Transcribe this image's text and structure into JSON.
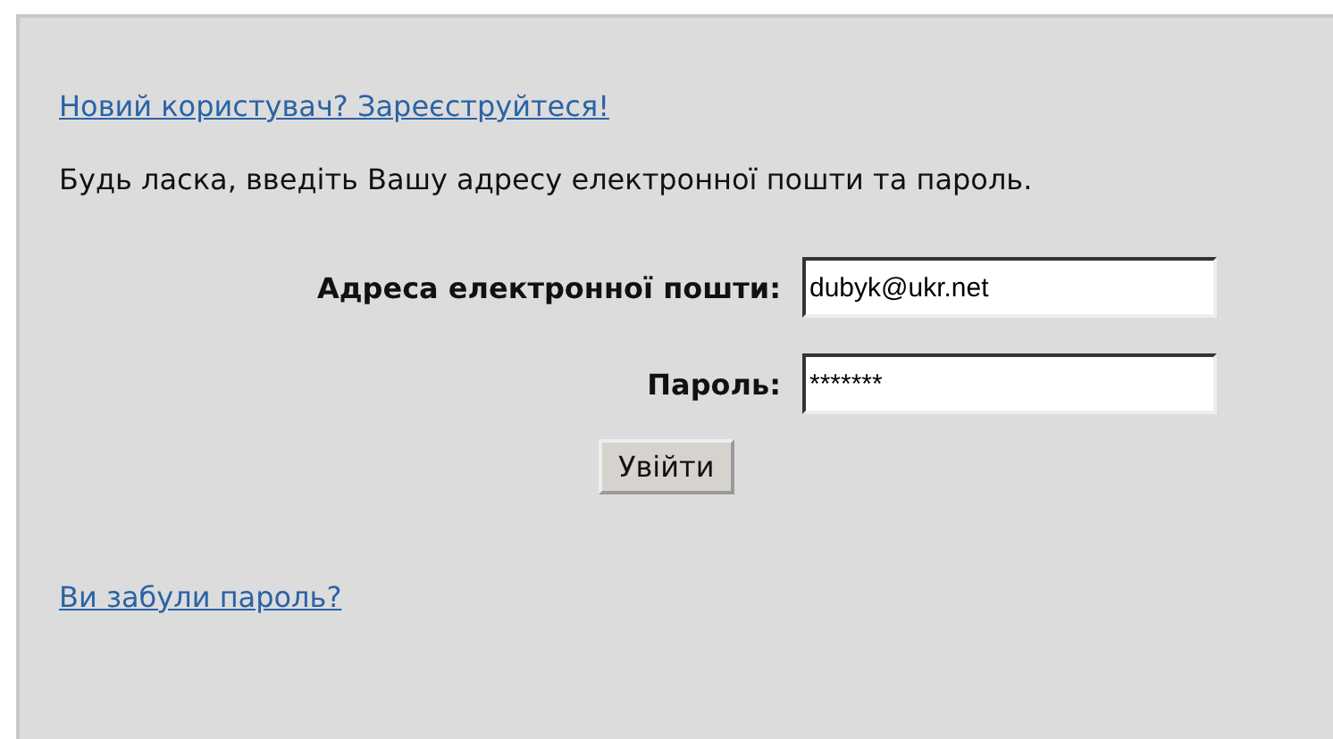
{
  "register_link": "Новий користувач? Зареєструйтеся!",
  "instructions": "Будь ласка, введіть Вашу адресу електронної пошти та пароль.",
  "fields": [
    {
      "label": "Адреса електронної пошти:",
      "value": "dubyk@ukr.net"
    },
    {
      "label": "Пароль:",
      "value": "*******"
    }
  ],
  "login_button": "Увійти",
  "forgot_link": "Ви забули пароль?"
}
